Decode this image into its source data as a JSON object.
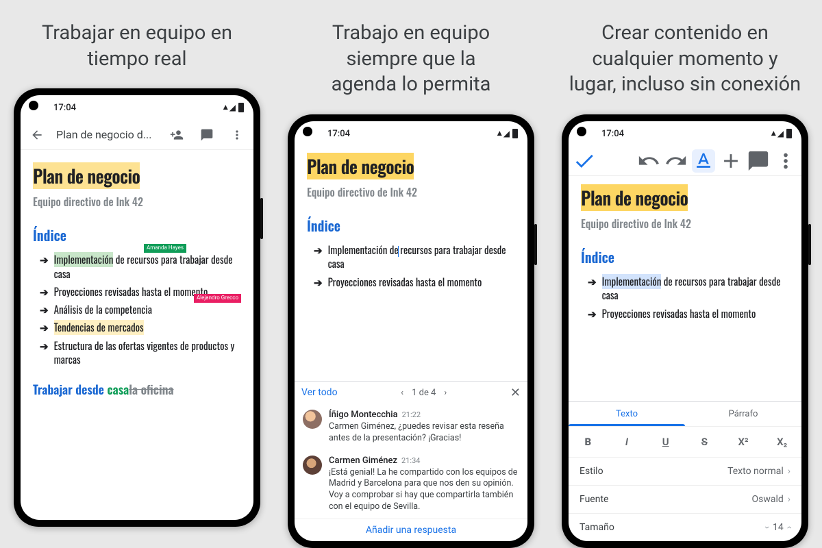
{
  "taglines": [
    "Trabajar en equipo en\ntiempo real",
    "Trabajo en equipo\nsiempre que la\nagenda lo permita",
    "Crear contenido en\ncualquier momento y\nlugar, incluso sin conexión"
  ],
  "status_time": "17:04",
  "doc": {
    "title": "Plan de negocio",
    "subtitle": "Equipo directivo de Ink 42",
    "toc_heading": "Índice"
  },
  "phone1": {
    "appbar_title": "Plan de negocio d...",
    "toc": [
      "Implementación de recursos para trabajar desde casa",
      "Proyecciones revisadas hasta el momento",
      "Análisis de la competencia",
      "Tendencias de mercados",
      "Estructura de las ofertas vigentes de productos y marcas"
    ],
    "collab1": "Amanda Hayes",
    "collab2": "Alejandro Grecco",
    "section2_prefix": "Trabajar desde ",
    "section2_green": "casa",
    "section2_strike": "la oficina"
  },
  "phone2": {
    "toc": [
      "Implementación de recursos para trabajar desde casa",
      "Proyecciones revisadas hasta el momento"
    ],
    "see_all": "Ver todo",
    "pager": "1 de 4",
    "comments": [
      {
        "author": "Íñigo Montecchia",
        "time": "21:22",
        "text": "Carmen Giménez, ¿puedes revisar esta reseña antes de la presentación? ¡Gracias!"
      },
      {
        "author": "Carmen Giménez",
        "time": "21:34",
        "text": "¡Está genial! La he compartido con los equipos de Madrid y Barcelona para que nos den su opinión. Voy a comprobar si hay que compartirla también con el equipo de Sevilla."
      }
    ],
    "add_reply": "Añadir una respuesta"
  },
  "phone3": {
    "toc": [
      "Implementación de recursos para trabajar desde casa",
      "Proyecciones revisadas hasta el momento"
    ],
    "tabs": {
      "text": "Texto",
      "paragraph": "Párrafo"
    },
    "format_buttons": {
      "bold": "B",
      "italic": "I",
      "underline": "U",
      "strike": "S",
      "super": "X²",
      "sub": "X₂"
    },
    "style": {
      "label": "Estilo",
      "value": "Texto normal"
    },
    "font": {
      "label": "Fuente",
      "value": "Oswald"
    },
    "size": {
      "label": "Tamaño",
      "value": "14"
    }
  }
}
